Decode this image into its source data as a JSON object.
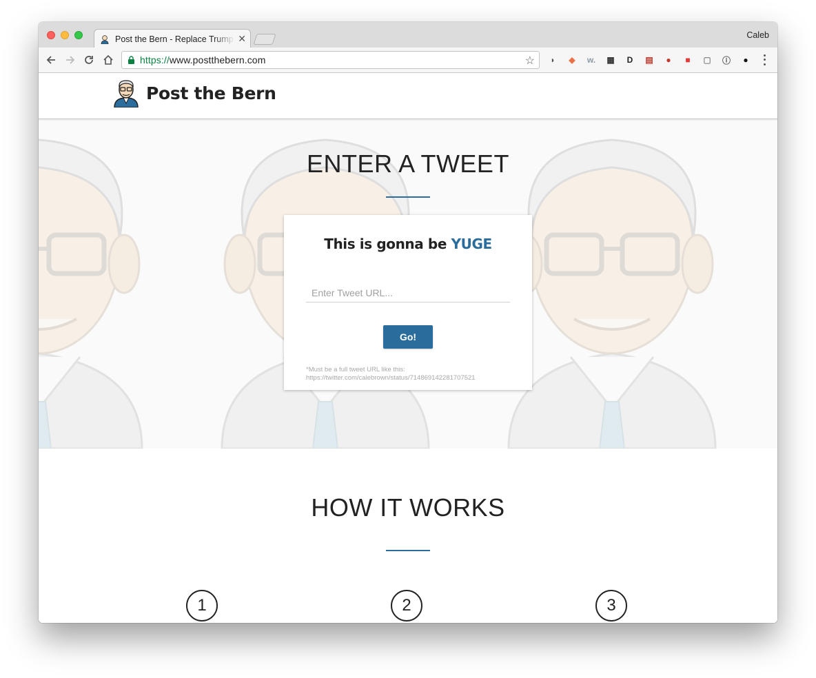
{
  "browser": {
    "tab_title": "Post the Bern - Replace Trump",
    "profile_name": "Caleb",
    "url_scheme": "https://",
    "url_host": "www.postthebern.com",
    "extensions": [
      "pocket-icon",
      "tab-icon",
      "w-icon",
      "film-icon",
      "d-icon",
      "flag-icon",
      "santa-icon",
      "bag-icon",
      "screen-icon",
      "info-icon",
      "p-icon"
    ]
  },
  "site": {
    "brand_name": "Post the Bern"
  },
  "hero": {
    "title": "ENTER A TWEET",
    "card_title_prefix": "This is gonna be ",
    "card_title_accent": "YUGE",
    "input_placeholder": "Enter Tweet URL...",
    "button_label": "Go!",
    "hint_line1": "*Must be a full tweet URL like this:",
    "hint_line2": "https://twitter.com/calebrown/status/714869142281707521"
  },
  "how": {
    "title": "HOW IT WORKS",
    "steps": [
      "1",
      "2",
      "3"
    ]
  },
  "colors": {
    "accent": "#2a6d9c"
  }
}
